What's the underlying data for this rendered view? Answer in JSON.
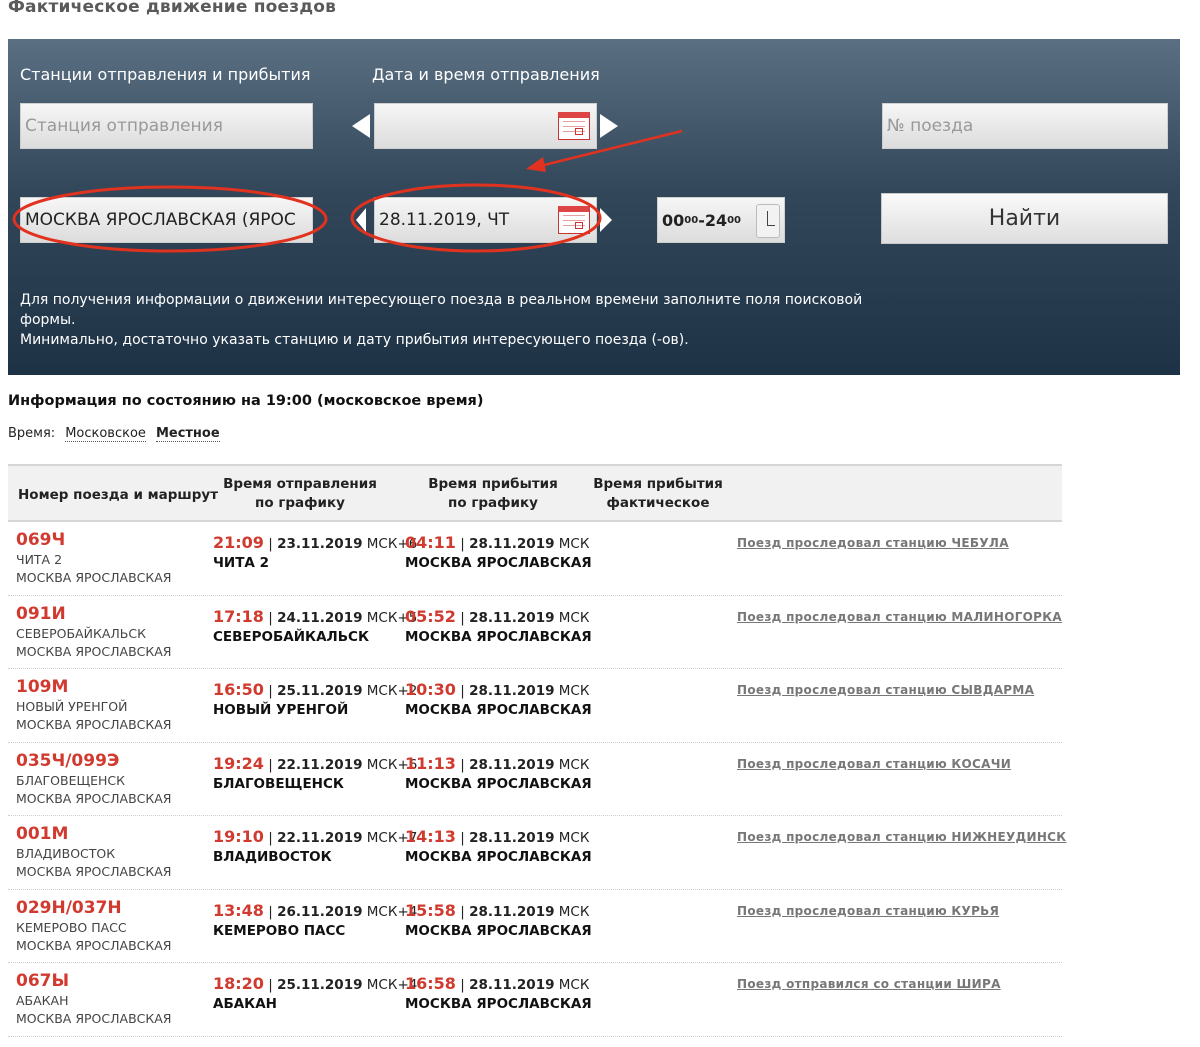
{
  "page": {
    "title": "Фактическое движение поездов"
  },
  "search": {
    "stations_label": "Станции отправления и прибытия",
    "date_label": "Дата и время отправления",
    "departure_placeholder": "Станция отправления",
    "train_placeholder": "№ поезда",
    "station_value": "МОСКВА ЯРОСЛАВСКАЯ (ЯРОС",
    "date_value": "28.11.2019, ЧТ",
    "time_from": "00",
    "time_from_sup": "00",
    "time_sep": "-",
    "time_to": "24",
    "time_to_sup": "00",
    "find_label": "Найти",
    "note_line1": "Для получения информации о движении интересующего поезда в реальном времени заполните поля поисковой формы.",
    "note_line2": "Минимально, достаточно указать станцию и дату прибытия интересующего поезда (-ов)."
  },
  "info": {
    "status": "Информация по состоянию на 19:00 (московское время)",
    "time_label": "Время:",
    "time_moscow": "Московское",
    "time_local": "Местное"
  },
  "table": {
    "headers": {
      "route": "Номер поезда и маршрут",
      "dep_line1": "Время отправления",
      "dep_line2": "по графику",
      "arr_line1": "Время прибытия",
      "arr_line2": "по графику",
      "fact_line1": "Время прибытия",
      "fact_line2": "фактическое"
    },
    "rows": [
      {
        "train": "069Ч",
        "from": "ЧИТА 2",
        "to": "МОСКВА ЯРОСЛАВСКАЯ",
        "dep_time": "21:09",
        "dep_date": "23.11.2019",
        "dep_tz": "МСК+6",
        "dep_station": "ЧИТА 2",
        "arr_time": "04:11",
        "arr_date": "28.11.2019",
        "arr_tz": "МСК",
        "arr_station": "МОСКВА ЯРОСЛАВСКАЯ",
        "status": "Поезд проследовал станцию ЧЕБУЛА"
      },
      {
        "train": "091И",
        "from": "СЕВЕРОБАЙКАЛЬСК",
        "to": "МОСКВА ЯРОСЛАВСКАЯ",
        "dep_time": "17:18",
        "dep_date": "24.11.2019",
        "dep_tz": "МСК+5",
        "dep_station": "СЕВЕРОБАЙКАЛЬСК",
        "arr_time": "05:52",
        "arr_date": "28.11.2019",
        "arr_tz": "МСК",
        "arr_station": "МОСКВА ЯРОСЛАВСКАЯ",
        "status": "Поезд проследовал станцию МАЛИНОГОРКА"
      },
      {
        "train": "109М",
        "from": "НОВЫЙ УРЕНГОЙ",
        "to": "МОСКВА ЯРОСЛАВСКАЯ",
        "dep_time": "16:50",
        "dep_date": "25.11.2019",
        "dep_tz": "МСК+2",
        "dep_station": "НОВЫЙ УРЕНГОЙ",
        "arr_time": "10:30",
        "arr_date": "28.11.2019",
        "arr_tz": "МСК",
        "arr_station": "МОСКВА ЯРОСЛАВСКАЯ",
        "status": "Поезд проследовал станцию СЫВДАРМА"
      },
      {
        "train": "035Ч/099Э",
        "from": "БЛАГОВЕЩЕНСК",
        "to": "МОСКВА ЯРОСЛАВСКАЯ",
        "dep_time": "19:24",
        "dep_date": "22.11.2019",
        "dep_tz": "МСК+6",
        "dep_station": "БЛАГОВЕЩЕНСК",
        "arr_time": "11:13",
        "arr_date": "28.11.2019",
        "arr_tz": "МСК",
        "arr_station": "МОСКВА ЯРОСЛАВСКАЯ",
        "status": "Поезд проследовал станцию КОСАЧИ"
      },
      {
        "train": "001М",
        "from": "ВЛАДИВОСТОК",
        "to": "МОСКВА ЯРОСЛАВСКАЯ",
        "dep_time": "19:10",
        "dep_date": "22.11.2019",
        "dep_tz": "МСК+7",
        "dep_station": "ВЛАДИВОСТОК",
        "arr_time": "14:13",
        "arr_date": "28.11.2019",
        "arr_tz": "МСК",
        "arr_station": "МОСКВА ЯРОСЛАВСКАЯ",
        "status": "Поезд проследовал станцию НИЖНЕУДИНСК"
      },
      {
        "train": "029Н/037Н",
        "from": "КЕМЕРОВО ПАСС",
        "to": "МОСКВА ЯРОСЛАВСКАЯ",
        "dep_time": "13:48",
        "dep_date": "26.11.2019",
        "dep_tz": "МСК+4",
        "dep_station": "КЕМЕРОВО ПАСС",
        "arr_time": "15:58",
        "arr_date": "28.11.2019",
        "arr_tz": "МСК",
        "arr_station": "МОСКВА ЯРОСЛАВСКАЯ",
        "status": "Поезд проследовал станцию КУРЬЯ"
      },
      {
        "train": "067Ы",
        "from": "АБАКАН",
        "to": "МОСКВА ЯРОСЛАВСКАЯ",
        "dep_time": "18:20",
        "dep_date": "25.11.2019",
        "dep_tz": "МСК+4",
        "dep_station": "АБАКАН",
        "arr_time": "16:58",
        "arr_date": "28.11.2019",
        "arr_tz": "МСК",
        "arr_station": "МОСКВА ЯРОСЛАВСКАЯ",
        "status": "Поезд отправился со станции ШИРА"
      }
    ]
  },
  "colors": {
    "accent_red": "#d13a2f",
    "annotation_red": "#e0321e",
    "panel_dark": "#1e3246"
  }
}
